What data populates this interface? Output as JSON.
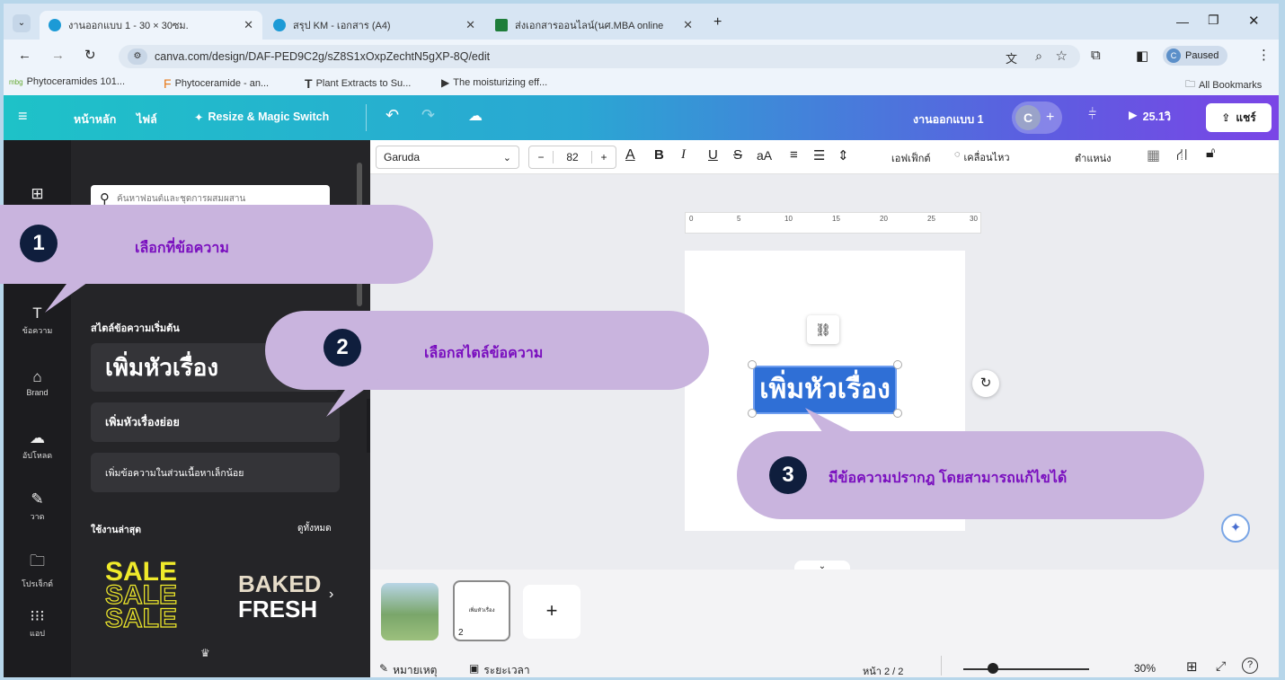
{
  "browser": {
    "tabs": [
      {
        "title": "งานออกแบบ 1 - 30 × 30ซม.",
        "color": "#1c9ad6"
      },
      {
        "title": "สรุป KM - เอกสาร (A4)",
        "color": "#1c9ad6"
      },
      {
        "title": "ส่งเอกสารออนไลน์(นศ.MBA online",
        "color": "#1e7d3a"
      }
    ],
    "new_tab": "+",
    "url": "canva.com/design/DAF-PED9C2g/sZ8S1xOxpZechtN5gXP-8Q/edit",
    "paused": "Paused",
    "bookmarks": [
      "Phytoceramides 101...",
      "Phytoceramide - an...",
      "Plant Extracts to Su...",
      "The moisturizing eff..."
    ],
    "all_bookmarks": "All Bookmarks"
  },
  "canva": {
    "menu": [
      "หน้าหลัก",
      "ไฟล์",
      "Resize & Magic Switch"
    ],
    "doc_title": "งานออกแบบ 1",
    "avatar": "C",
    "timer": "25.1วิ",
    "share": "แชร์",
    "search_placeholder": "ค้นหาฟอนต์และชุดการผสมผสาน",
    "rail": [
      "ข้อความ",
      "Brand",
      "อัปโหลด",
      "วาด",
      "โปรเจ็กต์",
      "แอป"
    ],
    "rail_top": "ออกแบบ",
    "panel": {
      "section_title": "สไตล์ข้อความเริ่มต้น",
      "heading": "เพิ่มหัวเรื่อง",
      "subheading": "เพิ่มหัวเรื่องย่อย",
      "body": "เพิ่มข้อความในส่วนเนื้อหาเล็กน้อย",
      "recent": "ใช้งานล่าสุด",
      "see_all": "ดูทั้งหมด",
      "sale": "SALE",
      "baked": "BAKED",
      "fresh": "FRESH"
    },
    "format": {
      "font": "Garuda",
      "size": "82",
      "minus": "−",
      "plus": "+",
      "effects": "เอฟเฟ็กต์",
      "animate": "เคลื่อนไหว",
      "position": "ตำแหน่ง"
    },
    "ruler": [
      "0",
      "5",
      "10",
      "15",
      "20",
      "25",
      "30"
    ],
    "canvas_text": "เพิ่มหัวเรื่อง",
    "bottom": {
      "notes": "หมายเหตุ",
      "timing": "ระยะเวลา",
      "page": "หน้า 2 / 2",
      "zoom": "30%",
      "thumb_label": "เพิ่มหัวเรื่อง",
      "thumb_num": "2",
      "add": "+"
    }
  },
  "callouts": [
    {
      "n": "1",
      "text": "เลือกที่ข้อความ"
    },
    {
      "n": "2",
      "text": "เลือกสไตล์ข้อความ"
    },
    {
      "n": "3",
      "text": "มีข้อความปรากฎ โดยสามารถแก้ไขได้"
    }
  ],
  "colors": {
    "callout_bg": "#c9b4de",
    "callout_text": "#7a0fbf",
    "num_bg": "#0f1e3d",
    "selection": "#2f6fd6"
  }
}
